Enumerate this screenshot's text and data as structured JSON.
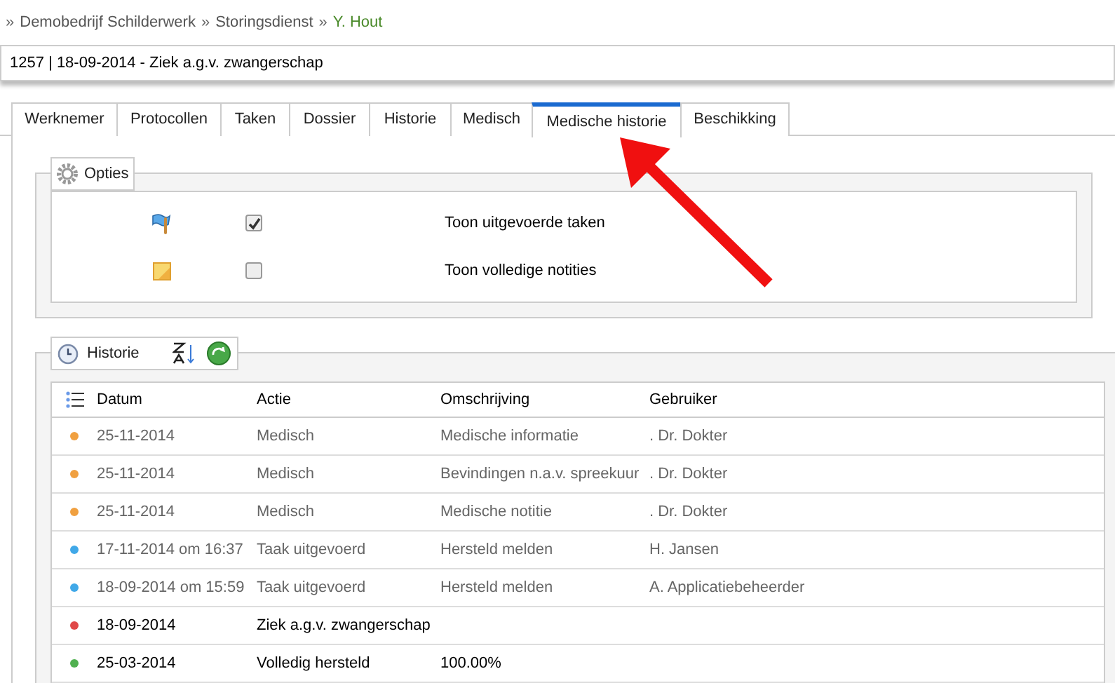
{
  "breadcrumb": [
    {
      "label": "Demobedrijf Schilderwerk",
      "separator": "»",
      "current": false
    },
    {
      "label": "Storingsdienst",
      "separator": "»",
      "current": false
    },
    {
      "label": "Y. Hout",
      "separator": "»",
      "current": true
    }
  ],
  "record_title": "1257 | 18-09-2014 - Ziek a.g.v. zwangerschap",
  "tabs": [
    {
      "label": "Werknemer",
      "selected": false
    },
    {
      "label": "Protocollen",
      "selected": false
    },
    {
      "label": "Taken",
      "selected": false
    },
    {
      "label": "Dossier",
      "selected": false
    },
    {
      "label": "Historie",
      "selected": false
    },
    {
      "label": "Medisch",
      "selected": false
    },
    {
      "label": "Medische historie",
      "selected": true
    },
    {
      "label": "Beschikking",
      "selected": false
    }
  ],
  "options": {
    "title": "Opties",
    "items": [
      {
        "kind": "flag",
        "checked": true,
        "label": "Toon uitgevoerde taken"
      },
      {
        "kind": "note",
        "checked": false,
        "label": "Toon volledige notities"
      }
    ]
  },
  "history": {
    "title": "Historie",
    "columns": [
      "Datum",
      "Actie",
      "Omschrijving",
      "Gebruiker"
    ],
    "rows": [
      {
        "color": "#f0a040",
        "muted": true,
        "datum": "25-11-2014",
        "actie": "Medisch",
        "omschrijving": "Medische informatie",
        "gebruiker": ". Dr. Dokter"
      },
      {
        "color": "#f0a040",
        "muted": true,
        "datum": "25-11-2014",
        "actie": "Medisch",
        "omschrijving": "Bevindingen n.a.v. spreekuur",
        "gebruiker": ". Dr. Dokter"
      },
      {
        "color": "#f0a040",
        "muted": true,
        "datum": "25-11-2014",
        "actie": "Medisch",
        "omschrijving": "Medische notitie",
        "gebruiker": ". Dr. Dokter"
      },
      {
        "color": "#40a8e8",
        "muted": true,
        "datum": "17-11-2014 om 16:37",
        "actie": "Taak uitgevoerd",
        "omschrijving": "Hersteld melden",
        "gebruiker": "H. Jansen"
      },
      {
        "color": "#40a8e8",
        "muted": true,
        "datum": "18-09-2014 om 15:59",
        "actie": "Taak uitgevoerd",
        "omschrijving": "Hersteld melden",
        "gebruiker": "A. Applicatiebeheerder"
      },
      {
        "color": "#e04848",
        "muted": false,
        "datum": "18-09-2014",
        "actie": "Ziek a.g.v. zwangerschap"
      },
      {
        "color": "#50b050",
        "muted": false,
        "datum": "25-03-2014",
        "actie": "Volledig hersteld",
        "omschrijving": "100.00%"
      }
    ]
  }
}
